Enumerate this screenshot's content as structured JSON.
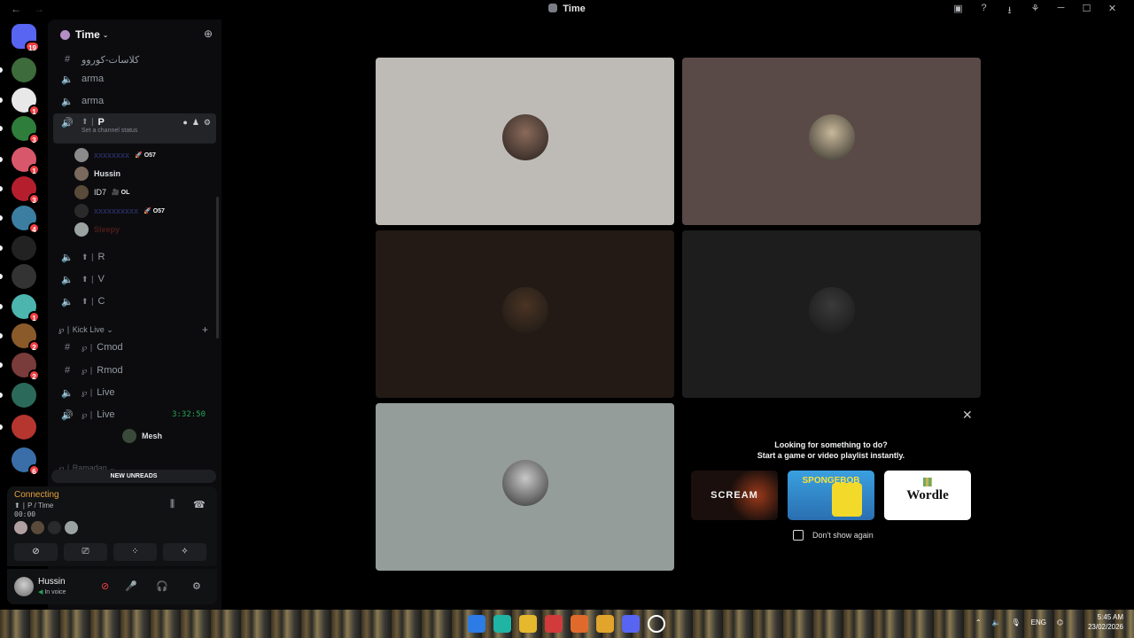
{
  "window": {
    "title": "Time",
    "nav_back": "←",
    "nav_fwd": "→",
    "controls": [
      "▣",
      "?",
      "⭳",
      "⚘",
      "─",
      "☐",
      "✕"
    ]
  },
  "server_rail": {
    "items": [
      {
        "name": "direct-messages",
        "badge": "19",
        "color": "#5865f2"
      },
      {
        "name": "server-mcs",
        "badge": "",
        "color": "#3d6b3b"
      },
      {
        "name": "server-2",
        "badge": "1",
        "color": "#e8e8e8"
      },
      {
        "name": "server-3",
        "badge": "3",
        "color": "#2f7d3a"
      },
      {
        "name": "server-4",
        "badge": "1",
        "color": "#d9576b"
      },
      {
        "name": "server-5",
        "badge": "3",
        "color": "#b51f2d"
      },
      {
        "name": "server-6",
        "badge": "4",
        "color": "#3b7ea1"
      },
      {
        "name": "server-logo",
        "badge": "",
        "color": "#222"
      },
      {
        "name": "server-8",
        "badge": "",
        "color": "#333"
      },
      {
        "name": "server-9",
        "badge": "1",
        "color": "#4cb5ae"
      },
      {
        "name": "server-10",
        "badge": "2",
        "color": "#8a5a2b"
      },
      {
        "name": "server-11",
        "badge": "2",
        "color": "#7a3b3b"
      },
      {
        "name": "server-12",
        "badge": "",
        "color": "#2b6a5a"
      },
      {
        "name": "server-13",
        "badge": "",
        "color": "#b5352f"
      },
      {
        "name": "server-14",
        "badge": "6",
        "color": "#3a6ea8"
      }
    ]
  },
  "guild": {
    "name": "Time",
    "chev": "⌄",
    "invite_icon": "person-add-icon"
  },
  "channels": {
    "top": [
      {
        "name": "كلاسات-كوروو",
        "type": "text"
      },
      {
        "name": "arma",
        "type": "voice"
      },
      {
        "name": "arma",
        "type": "voice"
      }
    ],
    "active": {
      "sub": "⬆ ∣",
      "name": "P",
      "status": "Set a channel status"
    },
    "voice_users": [
      {
        "name": "xxxxxxxx",
        "tag": "🚀 O57",
        "style": "dim",
        "color": "#8a8a8a"
      },
      {
        "name": "Hussin",
        "tag": "",
        "style": "bold",
        "color": "#7a6a5e"
      },
      {
        "name": "ID7",
        "tag": "🎥 OL",
        "style": "normal",
        "color": "#5a4a3a"
      },
      {
        "name": "xxxxxxxxxx",
        "tag": "🚀 O57",
        "style": "dim",
        "color": "#2a2a2a"
      },
      {
        "name": "Sleepy",
        "tag": "",
        "style": "dimr",
        "color": "#9aa3a0"
      }
    ],
    "more": [
      {
        "sub": "⬆ ∣",
        "name": "R"
      },
      {
        "sub": "⬆ ∣",
        "name": "V"
      },
      {
        "sub": "⬆ ∣",
        "name": "C"
      }
    ],
    "category": {
      "name": "℘ ∣ Kick Live ⌄",
      "plus": "+"
    },
    "kick": [
      {
        "sub": "℘ ∣",
        "name": "Cmod",
        "type": "text"
      },
      {
        "sub": "℘ ∣",
        "name": "Rmod",
        "type": "text"
      },
      {
        "sub": "℘ ∣",
        "name": "Live",
        "type": "voice"
      },
      {
        "sub": "℘ ∣",
        "name": "Live",
        "type": "voice-live",
        "timer": "3:32:50"
      }
    ],
    "kick_user": {
      "name": "Mesh",
      "color": "#3a4a3a"
    },
    "cut_category": "℘ ∣ Ramadan ⌄"
  },
  "new_unreads": "NEW UNREADS",
  "voice_panel": {
    "status": "Connecting",
    "channel": "⬆ ∣ P / Time",
    "elapsed": "00:00",
    "participant_colors": [
      "#b0a0a0",
      "#5a4a3a",
      "#2a2a2a",
      "#9aa3a0"
    ],
    "buttons": [
      "⊘",
      "⎚",
      "⁘",
      "✧"
    ]
  },
  "user": {
    "name": "Hussin",
    "status": "In voice",
    "mute_icon": "🎤",
    "deafen_icon": "🎧",
    "settings_icon": "⚙"
  },
  "tiles": [
    {
      "name": "tile-1",
      "bg": "#bebbb6",
      "pfp": "#8a6a5a"
    },
    {
      "name": "tile-2",
      "bg": "#594947",
      "pfp": "#c8b89a"
    },
    {
      "name": "tile-3",
      "bg": "#231a15",
      "pfp": "#4a3424"
    },
    {
      "name": "tile-4",
      "bg": "#1d1d1d",
      "pfp": "#3a3a3a"
    },
    {
      "name": "tile-5",
      "bg": "#949d99",
      "pfp": "#c8c8c8"
    }
  ],
  "activity_promo": {
    "line1": "Looking for something to do?",
    "line2": "Start a game or video playlist instantly.",
    "games": [
      {
        "name": "SCREAM",
        "bg": "#1a0f0c",
        "fg": "#f2f2f2"
      },
      {
        "name": "SPONGEBOB",
        "bg": "#2f8fd0",
        "fg": "#f7e13a"
      },
      {
        "name": "Wordle",
        "bg": "#ffffff",
        "fg": "#121213"
      }
    ],
    "dont_show": "Don't show again",
    "close": "✕"
  },
  "taskbar": {
    "apps": [
      "#2d7be5",
      "#1fb4a4",
      "#e5b82d",
      "#d23b3b",
      "#e06a2b",
      "#e1a52b",
      "#5865f2",
      "#ffffff"
    ],
    "lang": "ENG",
    "time": "5:45 AM",
    "date": "23/02/2026",
    "tray_up": "⌃"
  }
}
